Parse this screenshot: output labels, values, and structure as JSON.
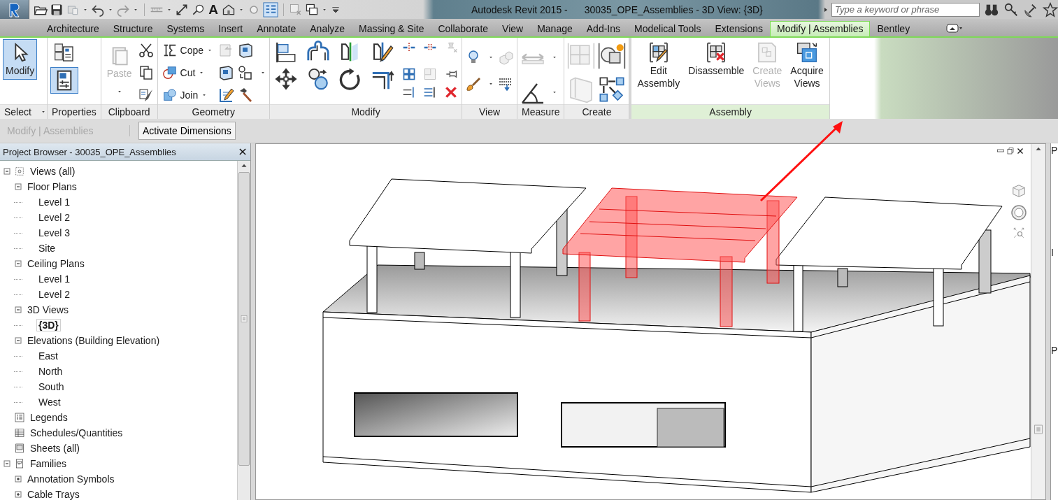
{
  "window": {
    "app_title": "Autodesk Revit 2015 -",
    "document_title": "30035_OPE_Assemblies - 3D View: {3D}"
  },
  "quick_access": {
    "text_tool": "A"
  },
  "search": {
    "placeholder": "Type a keyword or phrase"
  },
  "tabs": [
    {
      "label": "Architecture",
      "selected": false
    },
    {
      "label": "Structure",
      "selected": false
    },
    {
      "label": "Systems",
      "selected": false
    },
    {
      "label": "Insert",
      "selected": false
    },
    {
      "label": "Annotate",
      "selected": false
    },
    {
      "label": "Analyze",
      "selected": false
    },
    {
      "label": "Massing & Site",
      "selected": false
    },
    {
      "label": "Collaborate",
      "selected": false
    },
    {
      "label": "View",
      "selected": false
    },
    {
      "label": "Manage",
      "selected": false
    },
    {
      "label": "Add-Ins",
      "selected": false
    },
    {
      "label": "Modelical Tools",
      "selected": false
    },
    {
      "label": "Extensions",
      "selected": false
    },
    {
      "label": "Modify | Assemblies",
      "selected": true
    },
    {
      "label": "Bentley",
      "selected": false
    }
  ],
  "ribbon_panels": [
    {
      "kind": "select",
      "title": "Select",
      "contextual": false,
      "tools": [
        {
          "label": "Modify",
          "selected": true
        }
      ]
    },
    {
      "kind": "properties",
      "title": "Properties",
      "contextual": false,
      "tools": [
        {
          "selected": false
        },
        {
          "selected": true
        }
      ]
    },
    {
      "kind": "clipboard",
      "title": "Clipboard",
      "contextual": false,
      "tools": [
        {
          "label": "Paste",
          "disabled": true
        }
      ]
    },
    {
      "kind": "geometry",
      "title": "Geometry",
      "contextual": false,
      "tools": [
        {
          "label": "Cope"
        },
        {
          "label": "Cut"
        },
        {
          "label": "Join"
        }
      ]
    },
    {
      "kind": "modify",
      "title": "Modify",
      "contextual": false
    },
    {
      "kind": "view",
      "title": "View",
      "contextual": false
    },
    {
      "kind": "measure",
      "title": "Measure",
      "contextual": false
    },
    {
      "kind": "create",
      "title": "Create",
      "contextual": false
    },
    {
      "kind": "assembly",
      "title": "Assembly",
      "contextual": true,
      "tools": [
        {
          "label": "Edit Assembly",
          "disabled": false
        },
        {
          "label": "Disassemble",
          "disabled": false
        },
        {
          "label": "Create Views",
          "disabled": true
        },
        {
          "label": "Acquire Views",
          "disabled": false
        }
      ]
    }
  ],
  "options_bar": {
    "context": "Modify | Assemblies",
    "button": "Activate Dimensions"
  },
  "project_browser": {
    "title": "Project Browser - 30035_OPE_Assemblies",
    "tree": [
      {
        "label": "Views (all)",
        "kind": "views",
        "expanded": true,
        "selected": false,
        "children": [
          {
            "label": "Floor Plans",
            "expanded": true,
            "selected": false,
            "children": [
              {
                "label": "Level 1",
                "selected": false
              },
              {
                "label": "Level 2",
                "selected": false
              },
              {
                "label": "Level 3",
                "selected": false
              },
              {
                "label": "Site",
                "selected": false
              }
            ]
          },
          {
            "label": "Ceiling Plans",
            "expanded": true,
            "selected": false,
            "children": [
              {
                "label": "Level 1",
                "selected": false
              },
              {
                "label": "Level 2",
                "selected": false
              }
            ]
          },
          {
            "label": "3D Views",
            "expanded": true,
            "selected": false,
            "children": [
              {
                "label": "{3D}",
                "selected": true
              }
            ]
          },
          {
            "label": "Elevations (Building Elevation)",
            "expanded": true,
            "selected": false,
            "children": [
              {
                "label": "East",
                "selected": false
              },
              {
                "label": "North",
                "selected": false
              },
              {
                "label": "South",
                "selected": false
              },
              {
                "label": "West",
                "selected": false
              }
            ]
          }
        ]
      },
      {
        "label": "Legends",
        "kind": "legends",
        "selected": false
      },
      {
        "label": "Schedules/Quantities",
        "kind": "schedules",
        "selected": false
      },
      {
        "label": "Sheets (all)",
        "kind": "sheets",
        "selected": false
      },
      {
        "label": "Families",
        "kind": "families",
        "expanded": true,
        "selected": false,
        "children": [
          {
            "label": "Annotation Symbols",
            "expanded": false,
            "selected": false
          },
          {
            "label": "Cable Trays",
            "expanded": false,
            "selected": false
          }
        ]
      }
    ]
  },
  "properties_edge": {
    "labels": [
      "P",
      "I",
      "P"
    ]
  }
}
